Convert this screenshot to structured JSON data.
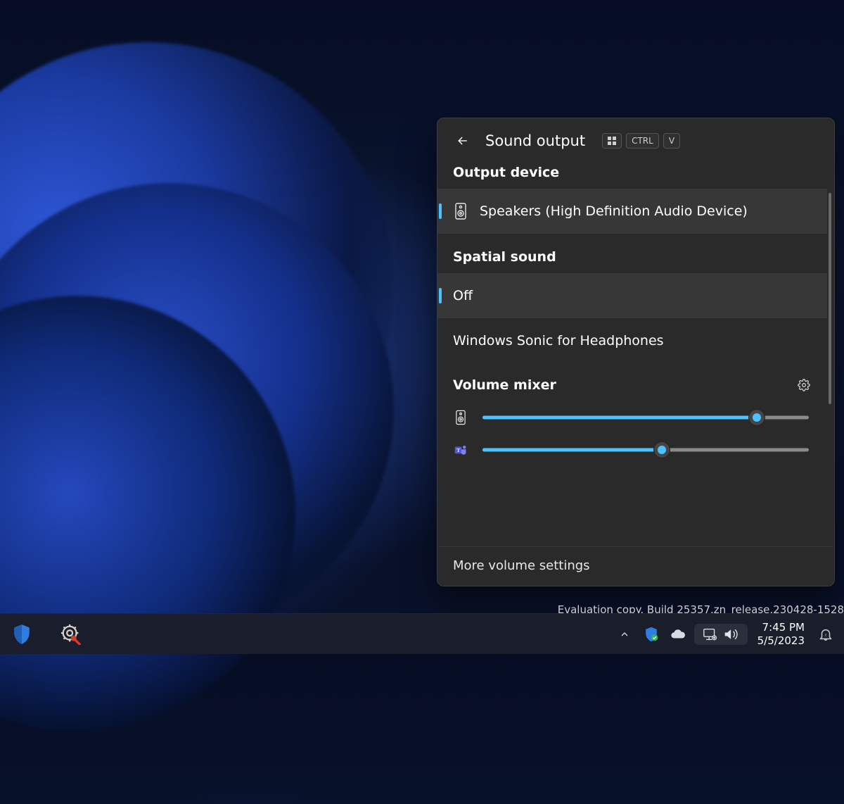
{
  "panel": {
    "title": "Sound output",
    "shortcut_keys": [
      "WIN",
      "CTRL",
      "V"
    ],
    "sections": {
      "output_label": "Output device",
      "output_device": "Speakers (High Definition Audio Device)",
      "spatial_label": "Spatial sound",
      "spatial_options": {
        "off": "Off",
        "sonic": "Windows Sonic for Headphones"
      },
      "mixer_label": "Volume mixer"
    },
    "mixer": {
      "system": {
        "name": "Speakers",
        "value": 84
      },
      "apps": [
        {
          "name": "Microsoft Teams",
          "value": 55
        }
      ]
    },
    "footer": "More volume settings"
  },
  "watermark": "Evaluation copy. Build 25357.zn_release.230428-1528",
  "taskbar": {
    "clock": {
      "time": "7:45 PM",
      "date": "5/5/2023"
    }
  }
}
